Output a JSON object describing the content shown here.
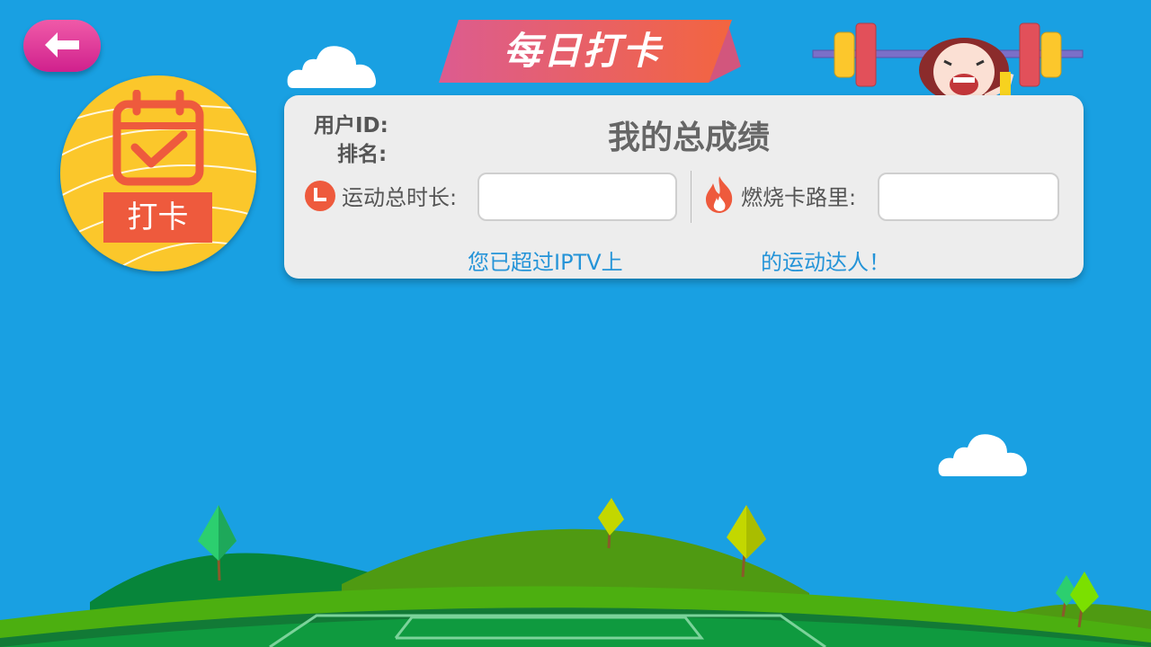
{
  "header": {
    "title": "每日打卡",
    "back_icon": "arrow-left-icon"
  },
  "checkin_badge": {
    "label": "打卡",
    "icon": "calendar-check-icon"
  },
  "summary_card": {
    "user_id_label": "用户ID:",
    "rank_label": "排名:",
    "title": "我的总成绩",
    "duration": {
      "label": "运动总时长:",
      "icon": "clock-icon",
      "value": ""
    },
    "calories": {
      "label": "燃烧卡路里:",
      "icon": "flame-icon",
      "value": ""
    },
    "message_part1": "您已超过IPTV上",
    "message_part2": "的运动达人！"
  },
  "colors": {
    "background": "#19a0e2",
    "badge": "#fbc72b",
    "accent_red": "#ee5a3d",
    "back_button": "#d0218d",
    "link_blue": "#2594d8"
  }
}
